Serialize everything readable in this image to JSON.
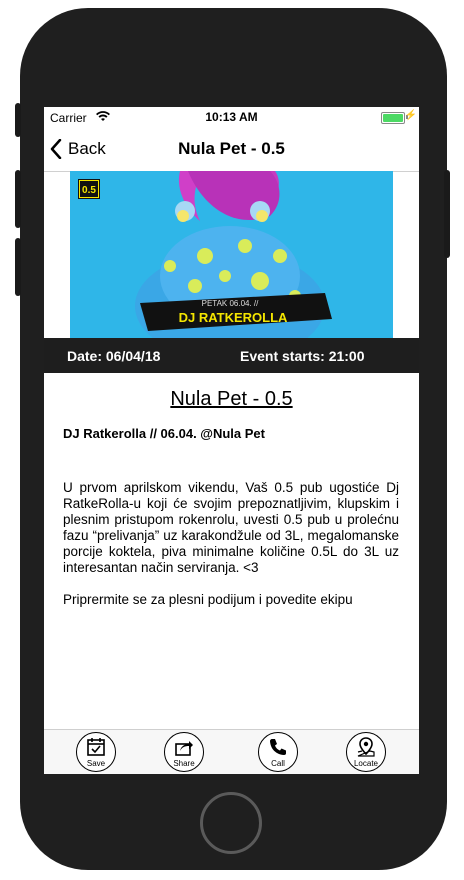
{
  "status": {
    "carrier": "Carrier",
    "time": "10:13 AM"
  },
  "nav": {
    "back_label": "Back",
    "title": "Nula Pet - 0.5"
  },
  "banner": {
    "badge": "0.5",
    "line1": "PETAK 06.04. //",
    "line2": "DJ RATKEROLLA"
  },
  "event": {
    "date_label": "Date: 06/04/18",
    "starts_label": "Event starts: 21:00",
    "title": "Nula Pet - 0.5",
    "subtitle": "DJ Ratkerolla // 06.04. @Nula Pet",
    "paragraph1": "U prvom aprilskom vikendu, Vaš 0.5 pub ugostiće Dj RatkeRolla-u koji će svojim prepoznatljivim, klupskim i plesnim pristupom rokenrolu, uvesti 0.5 pub u prolećnu fazu “prelivanja” uz karakondžule od 3L, megalomanske porcije koktela, piva minimalne količine 0.5L do 3L uz interesantan način serviranja. <3",
    "paragraph2": "Priprermite se za plesni podijum i povedite ekipu"
  },
  "toolbar": {
    "save": "Save",
    "share": "Share",
    "call": "Call",
    "locate": "Locate"
  }
}
